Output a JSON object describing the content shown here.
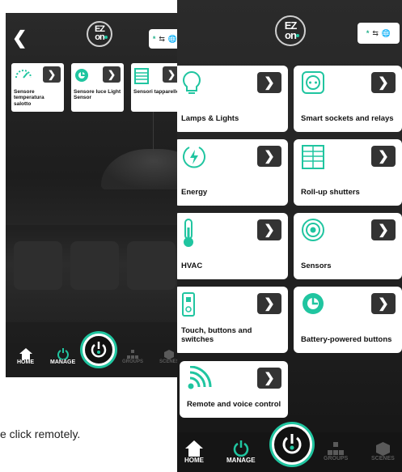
{
  "back_screen": {
    "cards": [
      {
        "label": "Sensore temperatura salotto",
        "icon": "gauge-icon"
      },
      {
        "label": "Sensore luce Light Sensor",
        "icon": "light-sensor-icon"
      },
      {
        "label": "Sensori tapparelle",
        "icon": "shutter-icon"
      }
    ],
    "nav": {
      "home": "HOME",
      "manage": "MANAGE",
      "groups": "GROUPS",
      "scenes": "SCENES"
    }
  },
  "front_screen": {
    "categories": [
      {
        "label": "Lamps & Lights",
        "icon": "lightbulb-icon"
      },
      {
        "label": "Smart sockets and relays",
        "icon": "socket-icon"
      },
      {
        "label": "Energy",
        "icon": "energy-icon"
      },
      {
        "label": "Roll-up shutters",
        "icon": "shutter-icon"
      },
      {
        "label": "HVAC",
        "icon": "thermometer-icon"
      },
      {
        "label": "Sensors",
        "icon": "sensor-icon"
      },
      {
        "label": "Touch, buttons and switches",
        "icon": "switch-icon"
      },
      {
        "label": "Battery-powered buttons",
        "icon": "battery-button-icon"
      },
      {
        "label": "Remote and voice control",
        "icon": "wifi-icon"
      }
    ],
    "nav": {
      "home": "HOME",
      "manage": "MANAGE",
      "groups": "GROUPS",
      "scenes": "SCENES"
    }
  },
  "logo": {
    "line1": "EZ",
    "line2": "on"
  },
  "caption": "e click remotely.",
  "colors": {
    "accent": "#20c5a0",
    "card": "#ffffff",
    "background": "#222222"
  }
}
